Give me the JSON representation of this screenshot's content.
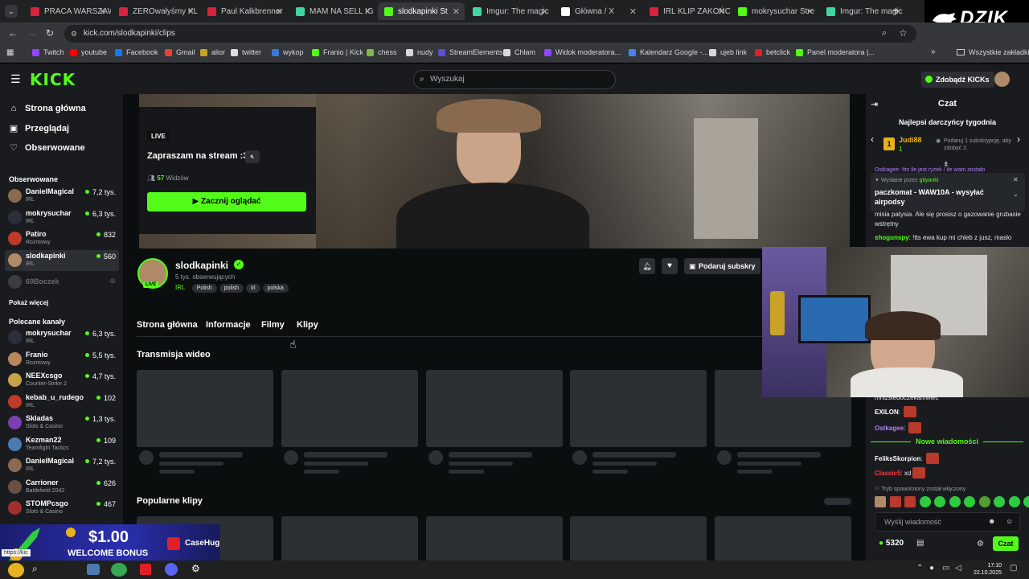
{
  "browser": {
    "tabs": [
      {
        "title": "PRACA WARSZAW",
        "color": "#d9223c"
      },
      {
        "title": "ZEROwałyśmy KL",
        "color": "#d9223c"
      },
      {
        "title": "Paul Kalkbrenner",
        "color": "#d9223c"
      },
      {
        "title": "MAM NA SELL IG",
        "color": "#3fd6a5"
      },
      {
        "title": "slodkapinki St",
        "color": "#53fc18",
        "active": true
      },
      {
        "title": "Imgur: The magic",
        "color": "#3fd6a5"
      },
      {
        "title": "Główna / X",
        "color": "#ffffff"
      },
      {
        "title": "IRL KLIP ZAKOŃC",
        "color": "#d9223c"
      },
      {
        "title": "mokrysuchar Stre",
        "color": "#53fc18"
      },
      {
        "title": "Imgur: The magic",
        "color": "#3fd6a5"
      }
    ],
    "new_tab": "+",
    "url": "kick.com/slodkapinki/clips",
    "bookmarks": [
      {
        "label": "Twitch",
        "color": "#9146ff"
      },
      {
        "label": "youtube",
        "color": "#ff0000"
      },
      {
        "label": "Facebook",
        "color": "#1877f2"
      },
      {
        "label": "Gmail",
        "color": "#ea4335"
      },
      {
        "label": "alior",
        "color": "#c9a227"
      },
      {
        "label": "twitter",
        "color": "#dddddd"
      },
      {
        "label": "wykop",
        "color": "#3a7bd5"
      },
      {
        "label": "Franio | Kick",
        "color": "#53fc18"
      },
      {
        "label": "chess",
        "color": "#81b64c"
      },
      {
        "label": "nudy",
        "color": "#d6d8da"
      },
      {
        "label": "StreamElements",
        "color": "#5a4fcf"
      },
      {
        "label": "Chłam",
        "color": "#d6d8da"
      },
      {
        "label": "Widok moderatora...",
        "color": "#9146ff"
      },
      {
        "label": "Kalendarz Google -...",
        "color": "#4285f4"
      },
      {
        "label": "ujeb link",
        "color": "#d6d8da"
      },
      {
        "label": "betclick",
        "color": "#e21f26"
      },
      {
        "label": "Panel moderatora |...",
        "color": "#53fc18"
      }
    ],
    "all_bookmarks": "Wszystkie zakładki"
  },
  "overlay": {
    "brand": "DZIK"
  },
  "kick": {
    "logo": "KICK",
    "search_placeholder": "Wyszukaj",
    "get_kicks": "Zdobądź KICKs",
    "accent": "#53fc18"
  },
  "sidebar": {
    "nav": [
      {
        "label": "Strona główna",
        "icon": "home-icon"
      },
      {
        "label": "Przeglądaj",
        "icon": "browse-icon"
      },
      {
        "label": "Obserwowane",
        "icon": "heart-icon"
      }
    ],
    "followed_header": "Obserwowane",
    "followed": [
      {
        "name": "DanielMagical",
        "category": "IRL",
        "viewers": "7,2 tys.",
        "color": "#8a6a50"
      },
      {
        "name": "mokrysuchar",
        "category": "IRL",
        "viewers": "6,3 tys.",
        "color": "#2b2f3a"
      },
      {
        "name": "Patiro",
        "category": "Rozmowy",
        "viewers": "832",
        "color": "#c0392b"
      },
      {
        "name": "slodkapinki",
        "category": "IRL",
        "viewers": "560",
        "color": "#b08968"
      }
    ],
    "offline": {
      "name": "69Boczek"
    },
    "show_more": "Pokaż więcej",
    "recommended_header": "Polecane kanały",
    "recommended": [
      {
        "name": "mokrysuchar",
        "category": "IRL",
        "viewers": "6,3 tys.",
        "color": "#2b2f3a"
      },
      {
        "name": "Franio",
        "category": "Rozmowy",
        "viewers": "5,5 tys.",
        "color": "#b8875c"
      },
      {
        "name": "NEEXcsgo",
        "category": "Counter-Strike 2",
        "viewers": "4,7 tys.",
        "color": "#c8a24a"
      },
      {
        "name": "kebab_u_rudego",
        "category": "IRL",
        "viewers": "102",
        "color": "#c0392b"
      },
      {
        "name": "Skladas",
        "category": "Slots & Casino",
        "viewers": "1,3 tys.",
        "color": "#7a3fb0"
      },
      {
        "name": "Kezman22",
        "category": "Teamfight Tactics",
        "viewers": "109",
        "color": "#4a7ab0"
      },
      {
        "name": "DanielMagical",
        "category": "IRL",
        "viewers": "7,2 tys.",
        "color": "#8a6a50"
      },
      {
        "name": "Carrioner",
        "category": "Battlefield 2042",
        "viewers": "626",
        "color": "#6a5040"
      },
      {
        "name": "STOMPcsgo",
        "category": "Slots & Casino",
        "viewers": "467",
        "color": "#a03030"
      }
    ]
  },
  "stream": {
    "live_badge": "LIVE",
    "title": "Zapraszam na stream :3",
    "viewers": "57",
    "viewers_label": "Widzów",
    "watch_button": "Zacznij oglądać",
    "channel": "slodkapinki",
    "followers": "5 tys. obserwujących",
    "category": "IRL",
    "tags": [
      "Polish",
      "polish",
      "irl",
      "polska"
    ],
    "avatar_live": "LIVE",
    "gift_button": "Podaruj subskry"
  },
  "channel_tabs": [
    "Strona główna",
    "Informacje",
    "Filmy",
    "Klipy"
  ],
  "sections": {
    "broadcast": "Transmisja wideo",
    "popular_clips": "Popularne klipy"
  },
  "chat": {
    "title": "Czat",
    "top_gifters": "Najlepsi darczyńcy tygodnia",
    "top_gifter": {
      "rank": "1",
      "name": "Judi88",
      "count": "1"
    },
    "gift_prompt": "Podaruj 1 subskrypcję, aby zdobyć 2.",
    "pinned_top": "Ostkagee: !tts ile jest ryżek / ile wam zostało",
    "sent_by_label": "Wysłane przez",
    "sent_by": "gityanki",
    "pinned_text": "paczkomat - WAW10A - wysyłać airpodsy",
    "messages": [
      {
        "user": "",
        "text": "misia patysia. Ale się prosisz o gazowanie grubasie wstrętny",
        "color": "#e4e6e8"
      },
      {
        "user": "shogunspy",
        "text": "!tts ewa kup mi chleb z jusz, masło",
        "color": "#53fc18"
      }
    ],
    "partial_line": "mnizsiedoczekamwiec",
    "lower_messages": [
      {
        "user": "EXILON",
        "text": "",
        "color": "#ffffff"
      },
      {
        "user": "Ostkagee",
        "text": "",
        "color": "#b57cff"
      }
    ],
    "new_messages": "Nowe wiadomości",
    "new": [
      {
        "user": "FeliksSkorpion",
        "text": "",
        "color": "#ffffff"
      },
      {
        "user": "Classic5",
        "text": "xd",
        "color": "#ff3b3b"
      }
    ],
    "slow_mode": "Tryb spowolniony został włączony",
    "input_placeholder": "Wyślij wiadomość",
    "kicks": "5320",
    "send_button": "Czat"
  },
  "ad": {
    "amount": "$1.00",
    "text": "WELCOME BONUS",
    "brand": "CaseHug"
  },
  "status": {
    "link": "https://kic"
  },
  "taskbar": {
    "time": "17:10",
    "date": "22.10.2025"
  }
}
